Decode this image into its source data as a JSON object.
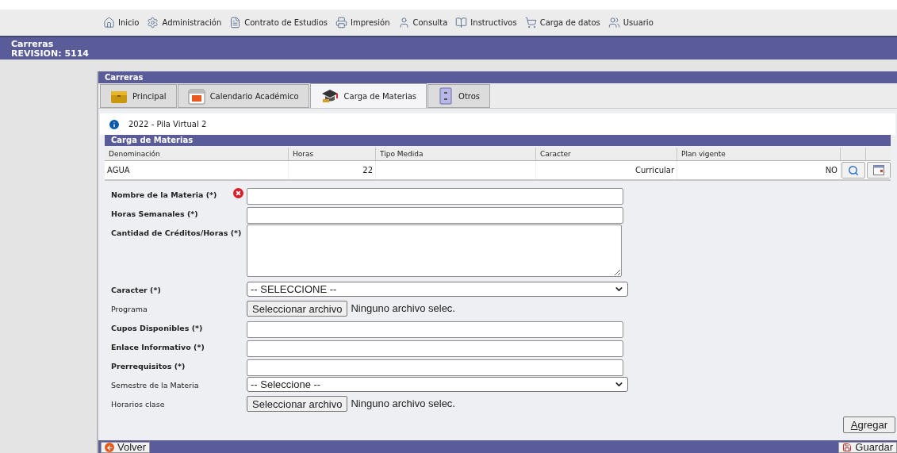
{
  "menu": [
    {
      "label": "Inicio"
    },
    {
      "label": "Administración"
    },
    {
      "label": "Contrato de Estudios"
    },
    {
      "label": "Impresión"
    },
    {
      "label": "Consulta"
    },
    {
      "label": "Instructivos"
    },
    {
      "label": "Carga de datos"
    },
    {
      "label": "Usuario"
    }
  ],
  "header": {
    "title": "Carreras",
    "revision": "REVISION: 5114"
  },
  "panel": {
    "title": "Carreras"
  },
  "tabs": [
    {
      "label": "Principal",
      "selected": false
    },
    {
      "label": "Calendario Académico",
      "selected": false
    },
    {
      "label": "Carga de Materias",
      "selected": true
    },
    {
      "label": "Otros",
      "selected": false
    }
  ],
  "info": "2022 - Pila Virtual 2",
  "section": "Carga de Materias",
  "table": {
    "columns": [
      "Denominación",
      "Horas",
      "Tipo Medida",
      "Caracter",
      "Plan vigente"
    ],
    "rows": [
      {
        "cells": [
          "AGUA",
          "22",
          "",
          "Curricular",
          "NO"
        ]
      }
    ]
  },
  "form": [
    {
      "label": "Nombre de la Materia (*)",
      "kind": "text",
      "required": true,
      "error": true
    },
    {
      "label": "Horas Semanales (*)",
      "kind": "text",
      "required": true,
      "error": false
    },
    {
      "label": "Cantidad de Créditos/Horas (*)",
      "kind": "textarea",
      "required": true,
      "error": false
    },
    {
      "label": "Caracter (*)",
      "kind": "select",
      "required": true,
      "error": false,
      "value": "-- SELECCIONE --"
    },
    {
      "label": "Programa",
      "kind": "file",
      "required": false,
      "error": false,
      "button": "Seleccionar archivo",
      "value": "Ninguno archivo selec."
    },
    {
      "label": "Cupos Disponibles (*)",
      "kind": "text",
      "required": true,
      "error": false
    },
    {
      "label": "Enlace Informativo (*)",
      "kind": "text",
      "required": true,
      "error": false
    },
    {
      "label": "Prerrequisitos (*)",
      "kind": "text",
      "required": true,
      "error": false
    },
    {
      "label": "Semestre de la Materia",
      "kind": "select",
      "required": false,
      "error": false,
      "value": "-- Seleccione --"
    },
    {
      "label": "Horarios clase",
      "kind": "file",
      "required": false,
      "error": false,
      "button": "Seleccionar archivo",
      "value": "Ninguno archivo selec."
    }
  ],
  "add_button": {
    "label": "Agregar",
    "underline_first": true
  },
  "footer": {
    "back": "Volver",
    "save": "Guardar"
  }
}
